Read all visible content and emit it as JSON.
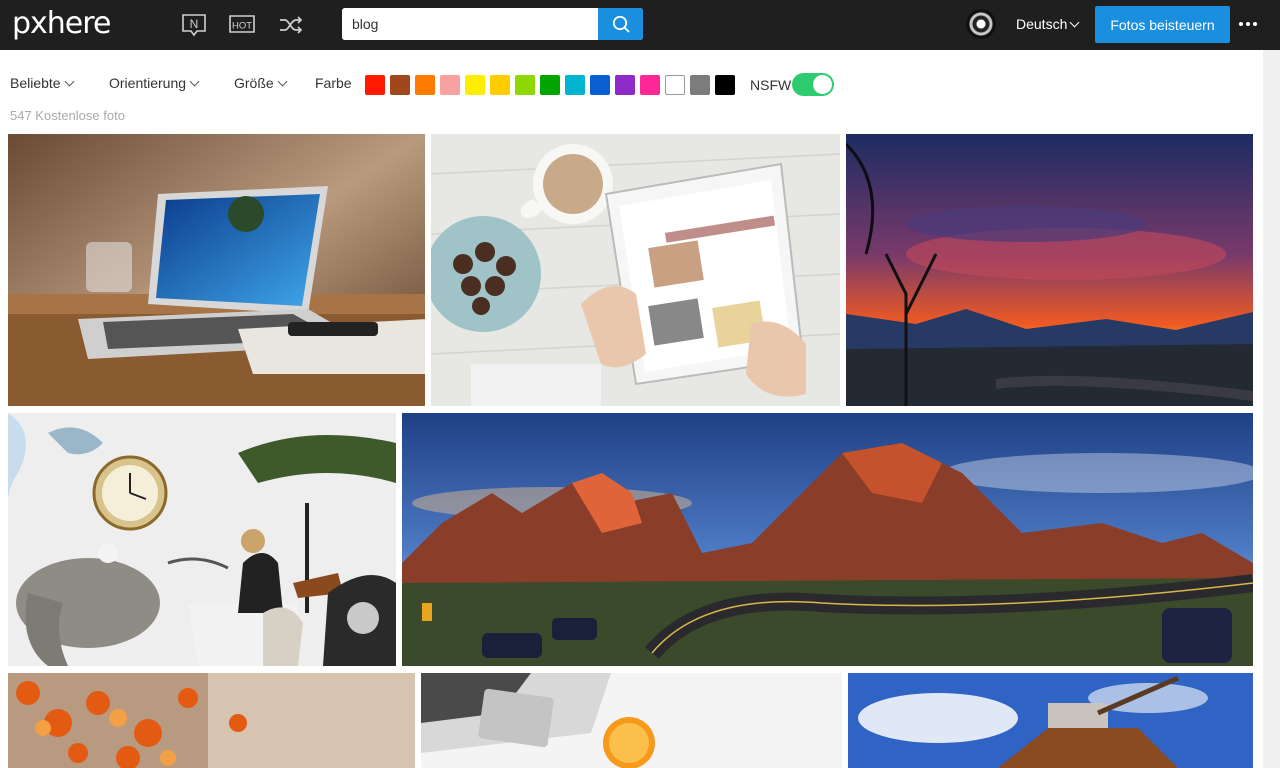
{
  "header": {
    "logo": "pxhere",
    "nav_icons": [
      "new-icon",
      "hot-icon",
      "shuffle-icon"
    ],
    "search": {
      "value": "blog",
      "placeholder": ""
    },
    "language": "Deutsch",
    "contribute_label": "Fotos beisteuern",
    "new_label": "N",
    "hot_label": "HOT"
  },
  "filters": {
    "popular": "Beliebte",
    "orientation": "Orientierung",
    "size": "Größe",
    "color_label": "Farbe",
    "colors": [
      "#ff1a00",
      "#a0481c",
      "#ff7a00",
      "#f7a1a1",
      "#ffee00",
      "#ffcc00",
      "#8ed700",
      "#00a500",
      "#00b4cf",
      "#0a5fd0",
      "#8e2bc8",
      "#ff2796",
      "#ffffff",
      "#7c7c7c",
      "#000000"
    ],
    "nsfw_label": "NSFW",
    "nsfw_on": true
  },
  "results": {
    "count_text": "547 Kostenlose foto"
  },
  "photos": [
    {
      "subject": "laptop-on-desk"
    },
    {
      "subject": "tablet-coffee-chocolates"
    },
    {
      "subject": "sunset-mountains"
    },
    {
      "subject": "collage-elephant-desk"
    },
    {
      "subject": "canyon-panorama"
    },
    {
      "subject": "autumn-leaves"
    },
    {
      "subject": "laptop-orange"
    },
    {
      "subject": "sky-water-tower"
    }
  ],
  "accent_color": "#1a8fe0",
  "header_bg": "#1f1f1f"
}
